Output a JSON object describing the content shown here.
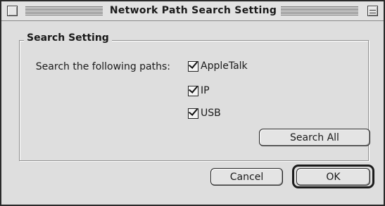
{
  "window": {
    "title": "Network Path Search Setting"
  },
  "group": {
    "title": "Search Setting"
  },
  "prompt": "Search the following paths:",
  "options": [
    {
      "label": "AppleTalk",
      "checked": true
    },
    {
      "label": "IP",
      "checked": true
    },
    {
      "label": "USB",
      "checked": true
    }
  ],
  "buttons": {
    "search_all": "Search All",
    "cancel": "Cancel",
    "ok": "OK"
  }
}
